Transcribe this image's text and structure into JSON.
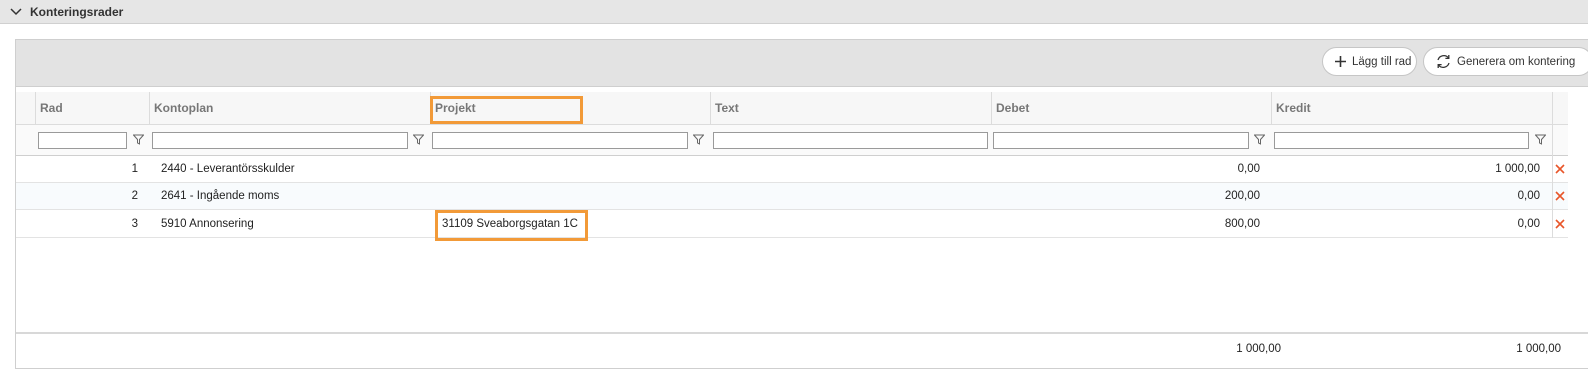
{
  "section": {
    "title": "Konteringsrader"
  },
  "toolbar": {
    "add_row_label": "Lägg till rad",
    "regenerate_label": "Generera om kontering"
  },
  "columns": {
    "rad": "Rad",
    "kontoplan": "Kontoplan",
    "projekt": "Projekt",
    "text": "Text",
    "debet": "Debet",
    "kredit": "Kredit"
  },
  "rows": [
    {
      "rad": "1",
      "kontoplan": "2440 - Leverantörsskulder",
      "projekt": "",
      "text": "",
      "debet": "0,00",
      "kredit": "1 000,00"
    },
    {
      "rad": "2",
      "kontoplan": "2641 - Ingående moms",
      "projekt": "",
      "text": "",
      "debet": "200,00",
      "kredit": "0,00"
    },
    {
      "rad": "3",
      "kontoplan": "5910 Annonsering",
      "projekt": "31109 Sveaborgsgatan 1C",
      "text": "",
      "debet": "800,00",
      "kredit": "0,00"
    }
  ],
  "totals": {
    "debet": "1 000,00",
    "kredit": "1 000,00"
  },
  "colors": {
    "delete": "#e8562a",
    "highlight": "#f29a38"
  }
}
